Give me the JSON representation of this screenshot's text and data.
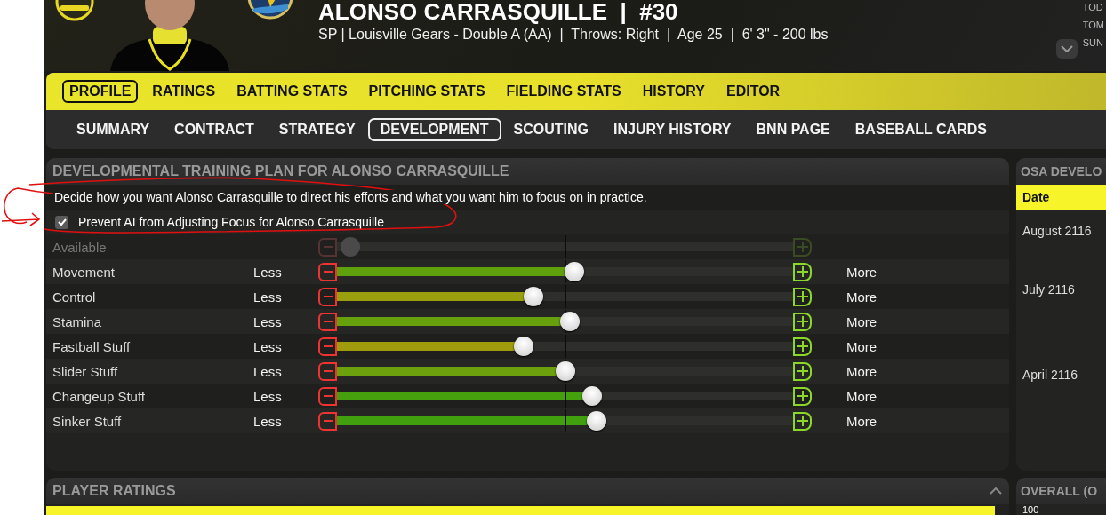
{
  "header": {
    "name": "ALONSO CARRASQUILLE  |  #30",
    "info": "SP | Louisville Gears - Double A (AA)  |  Throws: Right  |  Age 25  |  6' 3\" - 200 lbs",
    "side_items": [
      "TOD",
      "TOM",
      "SUN"
    ]
  },
  "main_tabs": [
    {
      "label": "PROFILE",
      "selected": true
    },
    {
      "label": "RATINGS",
      "selected": false
    },
    {
      "label": "BATTING STATS",
      "selected": false
    },
    {
      "label": "PITCHING STATS",
      "selected": false
    },
    {
      "label": "FIELDING STATS",
      "selected": false
    },
    {
      "label": "HISTORY",
      "selected": false
    },
    {
      "label": "EDITOR",
      "selected": false
    }
  ],
  "sub_tabs": [
    {
      "label": "SUMMARY",
      "selected": false
    },
    {
      "label": "CONTRACT",
      "selected": false
    },
    {
      "label": "STRATEGY",
      "selected": false
    },
    {
      "label": "DEVELOPMENT",
      "selected": true
    },
    {
      "label": "SCOUTING",
      "selected": false
    },
    {
      "label": "INJURY HISTORY",
      "selected": false
    },
    {
      "label": "BNN PAGE",
      "selected": false
    },
    {
      "label": "BASEBALL CARDS",
      "selected": false
    }
  ],
  "training_panel": {
    "title": "DEVELOPMENTAL TRAINING PLAN FOR ALONSO CARRASQUILLE",
    "description": "Decide how you want Alonso Carrasquille to direct his efforts and what you want him to focus on in practice.",
    "prevent_ai": {
      "label": "Prevent AI from Adjusting Focus for Alonso Carrasquille",
      "checked": true
    },
    "available": {
      "label": "Available",
      "level": 0.03,
      "disabled": true
    },
    "focus_rows": [
      {
        "name": "Movement",
        "less": "Less",
        "more": "More",
        "level": 0.52
      },
      {
        "name": "Control",
        "less": "Less",
        "more": "More",
        "level": 0.43
      },
      {
        "name": "Stamina",
        "less": "Less",
        "more": "More",
        "level": 0.51
      },
      {
        "name": "Fastball Stuff",
        "less": "Less",
        "more": "More",
        "level": 0.41
      },
      {
        "name": "Slider Stuff",
        "less": "Less",
        "more": "More",
        "level": 0.5
      },
      {
        "name": "Changeup Stuff",
        "less": "Less",
        "more": "More",
        "level": 0.56
      },
      {
        "name": "Sinker Stuff",
        "less": "Less",
        "more": "More",
        "level": 0.57
      }
    ]
  },
  "osa_panel": {
    "title": "OSA DEVELO",
    "column": "Date",
    "dates": [
      "August 2116",
      "July 2116",
      "April 2116"
    ]
  },
  "ratings_panel": {
    "title": "PLAYER RATINGS"
  },
  "overall_panel": {
    "title": "OVERALL (O",
    "axis_label": "100"
  }
}
